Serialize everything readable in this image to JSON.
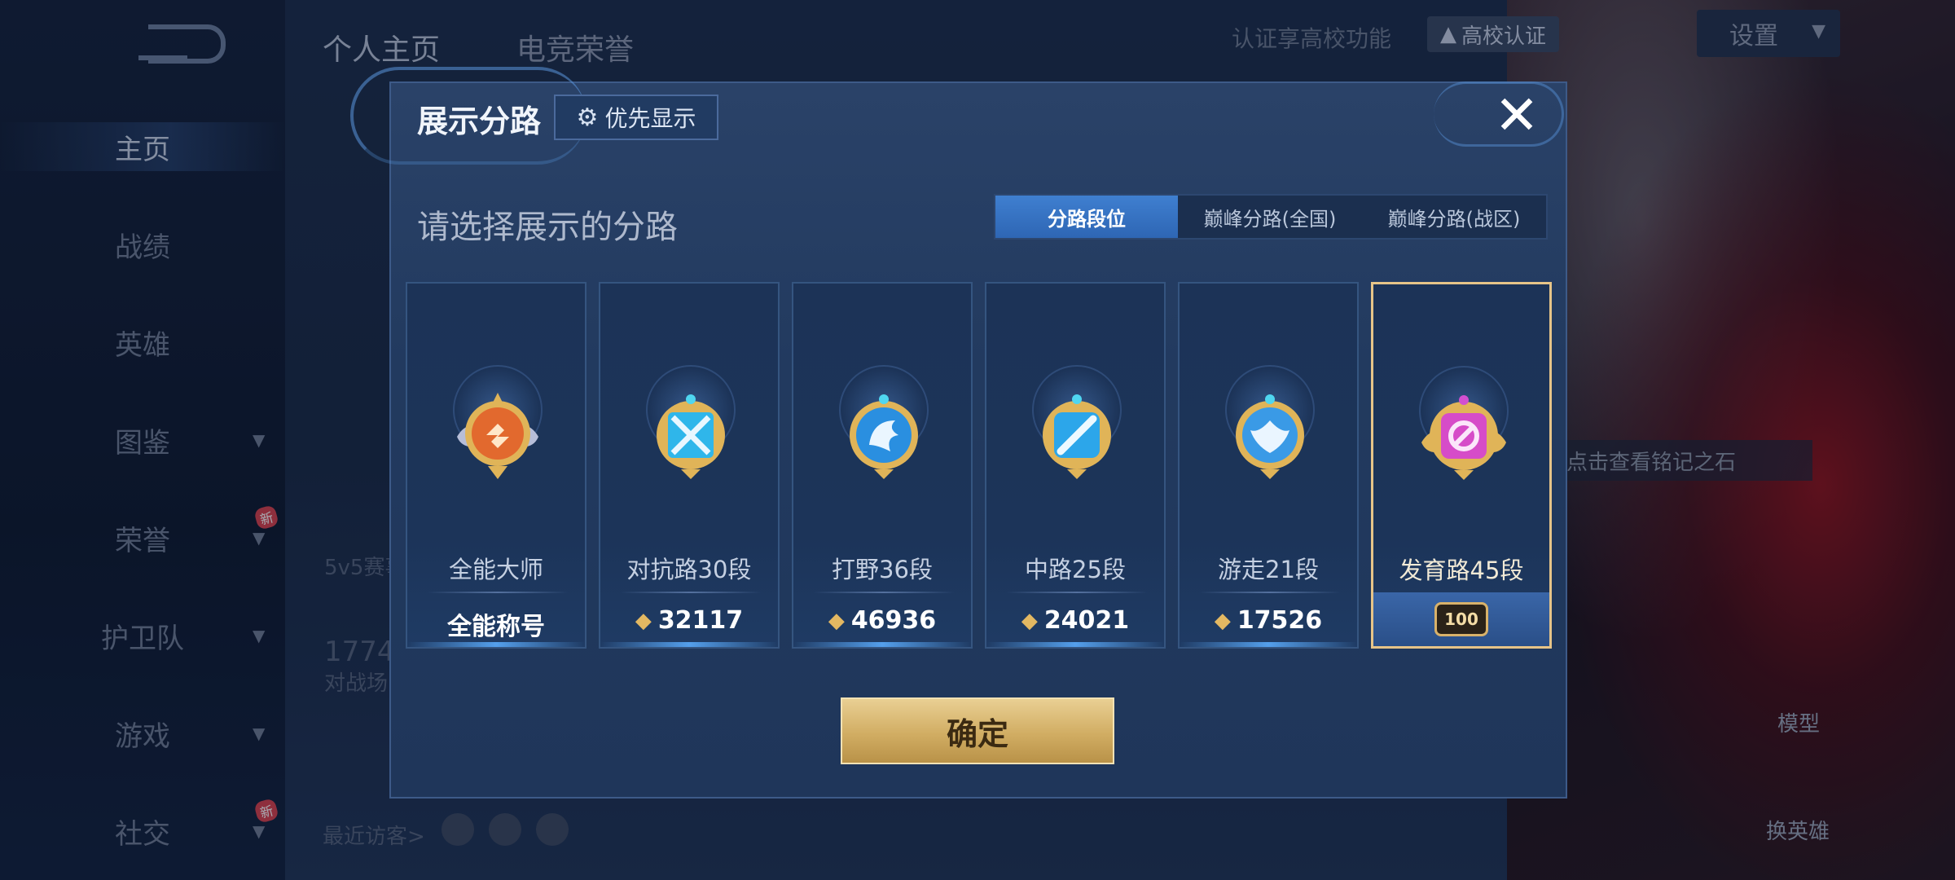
{
  "top_bar": {
    "tabs": [
      "个人主页",
      "电竞荣誉"
    ],
    "campus_text": "认证享高校功能",
    "campus_button": "高校认证",
    "settings_label": "设置"
  },
  "sidebar": {
    "items": [
      {
        "label": "主页",
        "active": true
      },
      {
        "label": "战绩"
      },
      {
        "label": "英雄"
      },
      {
        "label": "图鉴"
      },
      {
        "label": "荣誉",
        "new": "新"
      },
      {
        "label": "护卫队"
      },
      {
        "label": "游戏"
      },
      {
        "label": "社交",
        "new": "新"
      }
    ]
  },
  "background": {
    "visitors_label": "最近访客>",
    "profile_count": "1774",
    "profile_sub": "对战场",
    "mode_label": "5v5赛事",
    "right_hint": "点击查看铭记之石",
    "model_label": "模型",
    "switch_hero_label": "换英雄"
  },
  "modal": {
    "title": "展示分路",
    "priority_button": "优先显示",
    "subtitle": "请选择展示的分路",
    "tabs": [
      {
        "label": "分路段位",
        "active": true
      },
      {
        "label": "巅峰分路(全国)"
      },
      {
        "label": "巅峰分路(战区)"
      }
    ],
    "cards": [
      {
        "title": "全能大师",
        "value": "全能称号",
        "badge": "all-rounder",
        "color": "#e2692e"
      },
      {
        "title": "对抗路30段",
        "value": "32117",
        "badge": "clash-lane",
        "color": "#2fb6ea"
      },
      {
        "title": "打野36段",
        "value": "46936",
        "badge": "jungle",
        "color": "#2a8fe0"
      },
      {
        "title": "中路25段",
        "value": "24021",
        "badge": "mid-lane",
        "color": "#2ca6ea"
      },
      {
        "title": "游走21段",
        "value": "17526",
        "badge": "roam",
        "color": "#3a9ae6"
      },
      {
        "title": "发育路45段",
        "value": "100",
        "badge": "farm-lane",
        "color": "#d64cc8",
        "selected": true
      }
    ],
    "confirm_button": "确定"
  }
}
